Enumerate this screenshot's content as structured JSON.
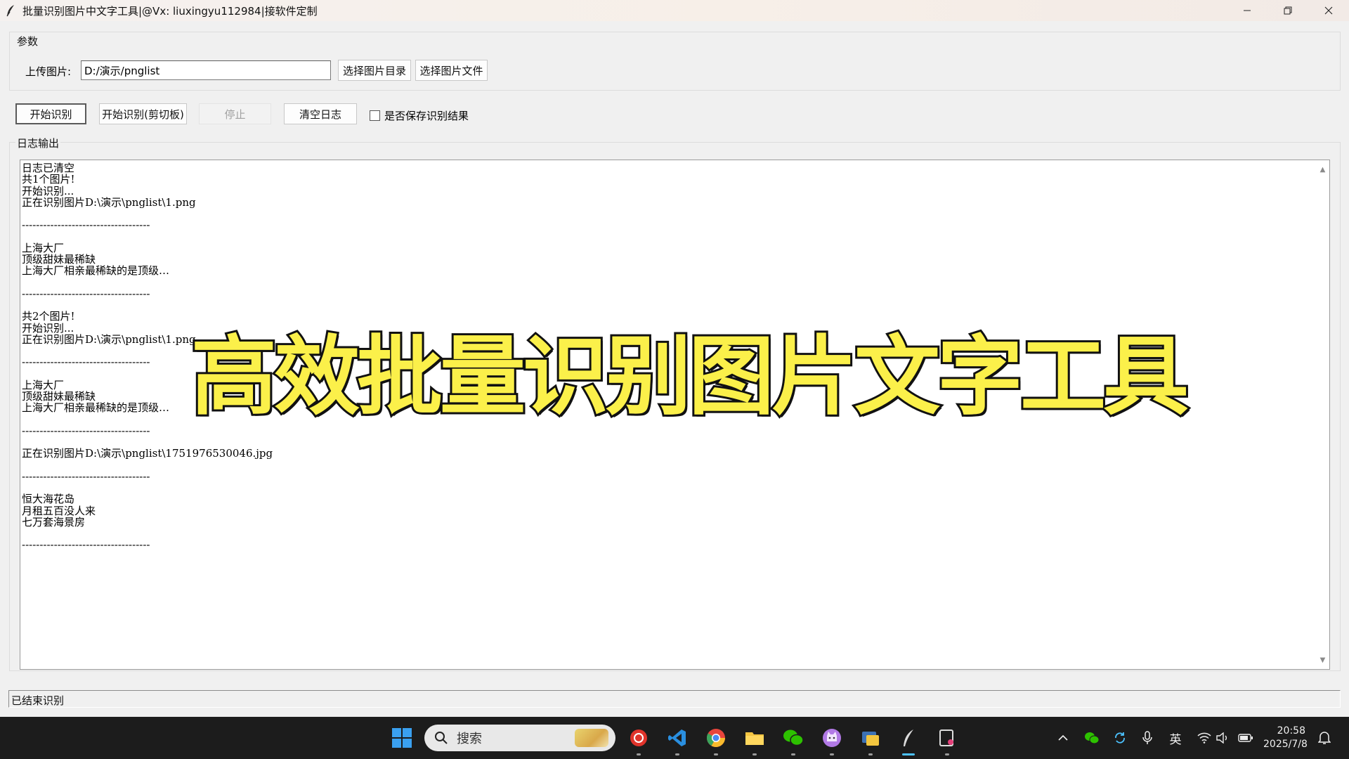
{
  "window": {
    "title": "批量识别图片中文字工具|@Vx: liuxingyu112984|接软件定制"
  },
  "params": {
    "group_label": "参数",
    "upload_label": "上传图片:",
    "path_value": "D:/演示/pnglist",
    "select_dir_label": "选择图片目录",
    "select_file_label": "选择图片文件"
  },
  "actions": {
    "start_label": "开始识别",
    "start_clipboard_label": "开始识别(剪切板)",
    "stop_label": "停止",
    "clear_log_label": "清空日志",
    "save_result_label": "是否保存识别结果",
    "save_result_checked": false
  },
  "log": {
    "group_label": "日志输出",
    "lines": [
      "日志已清空",
      "共1个图片!",
      "开始识别...",
      "正在识别图片D:\\演示\\pnglist\\1.png",
      "",
      "------------------------------------",
      "",
      "上海大厂",
      "顶级甜妹最稀缺",
      "上海大厂相亲最稀缺的是顶级…",
      "",
      "------------------------------------",
      "",
      "共2个图片!",
      "开始识别...",
      "正在识别图片D:\\演示\\pnglist\\1.png",
      "",
      "------------------------------------",
      "",
      "上海大厂",
      "顶级甜妹最稀缺",
      "上海大厂相亲最稀缺的是顶级…",
      "",
      "------------------------------------",
      "",
      "正在识别图片D:\\演示\\pnglist\\1751976530046.jpg",
      "",
      "------------------------------------",
      "",
      "恒大海花岛",
      "月租五百没人来",
      "七万套海景房",
      "",
      "------------------------------------"
    ]
  },
  "overlay": {
    "banner_text": "高效批量识别图片文字工具"
  },
  "status": {
    "text": "已结束识别"
  },
  "taskbar": {
    "search_placeholder": "搜索",
    "ime_label": "英",
    "time": "20:58",
    "date": "2025/7/8"
  }
}
